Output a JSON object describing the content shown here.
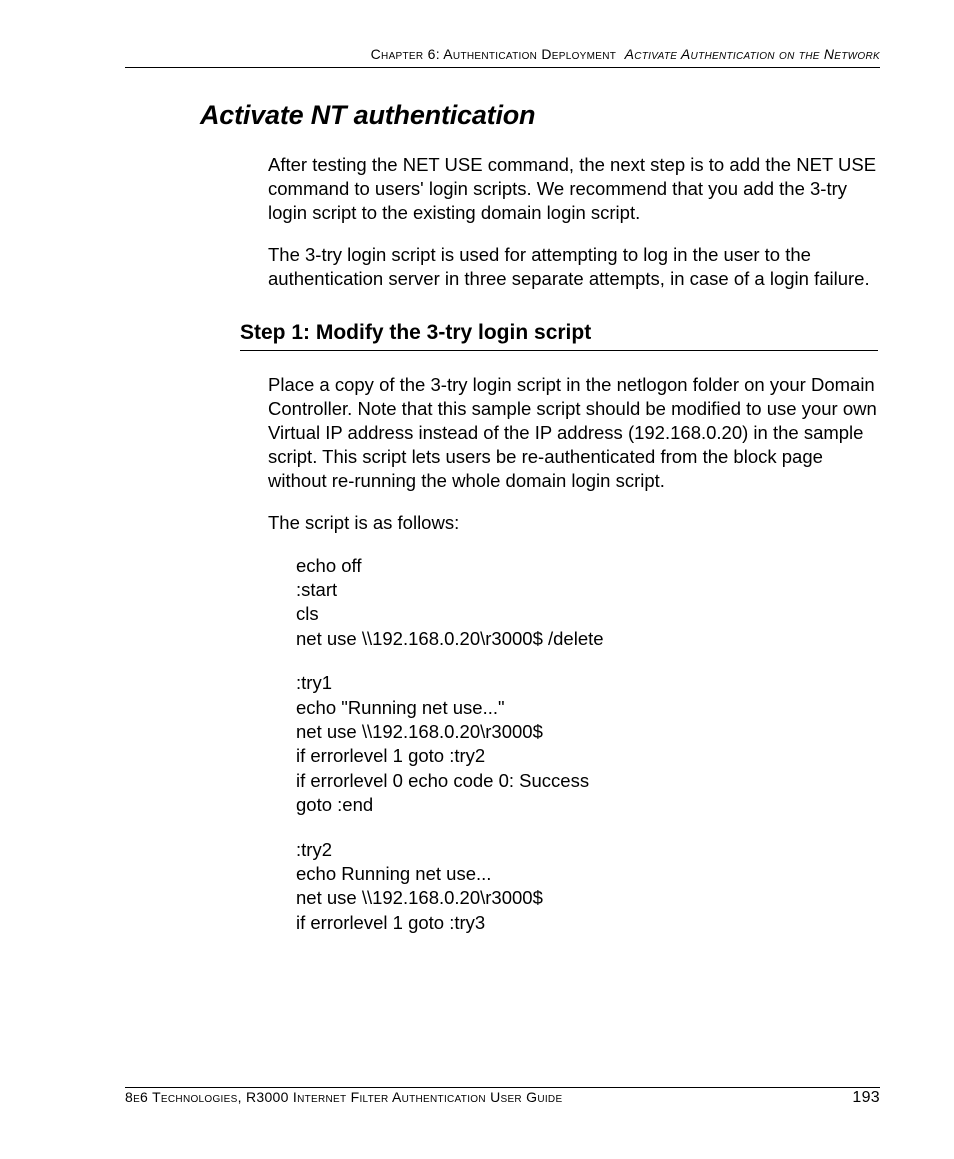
{
  "header": {
    "chapter": "Chapter 6: Authentication Deployment",
    "section": "Activate Authentication on the Network"
  },
  "title": "Activate NT authentication",
  "intro_paragraphs": [
    "After testing the NET USE command, the next step is to add the NET USE command to users' login scripts. We recommend that you add the 3-try login script to the existing domain login script.",
    "The 3-try login script is used for attempting to log in the user to the authentication server in three separate attempts, in case of a login failure."
  ],
  "step1": {
    "heading": "Step 1: Modify the 3-try login script",
    "paragraphs": [
      "Place a copy of the 3-try login script in the netlogon folder on your Domain Controller. Note that this sample script should be modified to use your own Virtual IP address instead of the IP address (192.168.0.20) in the sample script. This script lets users be re-authenticated from the block page without re-running the whole domain login script.",
      "The script is as follows:"
    ],
    "script_blocks": [
      [
        "echo off",
        ":start",
        "cls",
        "net use \\\\192.168.0.20\\r3000$ /delete"
      ],
      [
        ":try1",
        "echo \"Running net use...\"",
        "net use \\\\192.168.0.20\\r3000$",
        "if errorlevel 1 goto :try2",
        "if errorlevel 0 echo code 0: Success",
        "goto :end"
      ],
      [
        ":try2",
        "echo Running net use...",
        "net use \\\\192.168.0.20\\r3000$",
        "if errorlevel 1 goto :try3"
      ]
    ]
  },
  "footer": {
    "text": "8e6 Technologies, R3000 Internet Filter Authentication User Guide",
    "page_number": "193"
  }
}
